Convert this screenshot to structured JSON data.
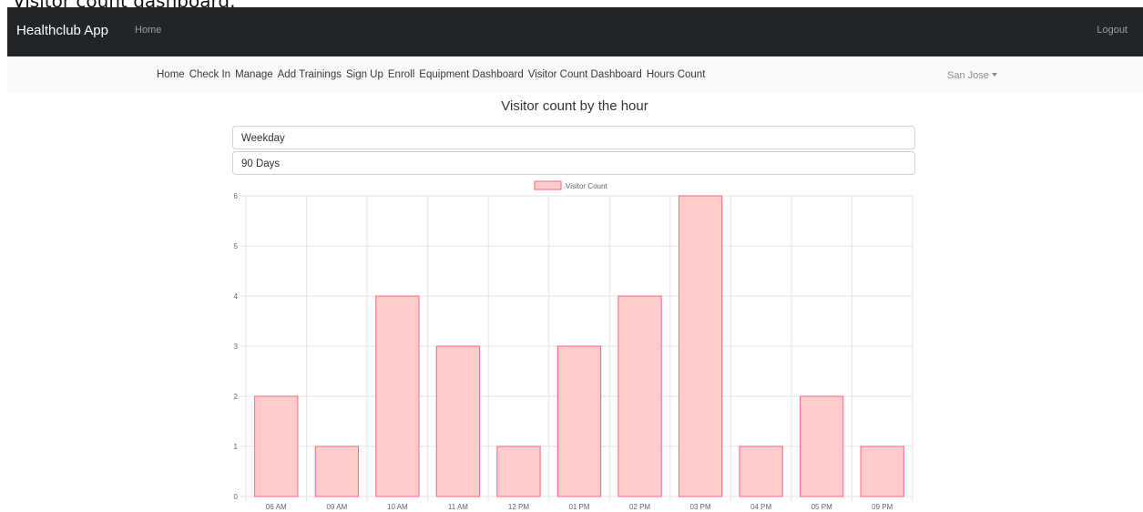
{
  "page": {
    "caption": "Visitor count dashboard:"
  },
  "navbar": {
    "brand": "Healthclub App",
    "home_link": "Home",
    "logout_label": "Logout"
  },
  "subnav": {
    "links": [
      "Home",
      "Check In",
      "Manage",
      "Add Trainings",
      "Sign Up",
      "Enroll",
      "Equipment Dashboard",
      "Visitor Count Dashboard",
      "Hours Count"
    ],
    "location": "San Jose"
  },
  "main": {
    "title": "Visitor count by the hour",
    "day_filter": "Weekday",
    "range_filter": "90 Days"
  },
  "colors": {
    "bar_fill": "#ffcccc",
    "bar_stroke": "#ff6384",
    "grid": "#e6e6e6",
    "tick_text": "#666666"
  },
  "chart_data": {
    "type": "bar",
    "categories": [
      "06 AM",
      "09 AM",
      "10 AM",
      "11 AM",
      "12 PM",
      "01 PM",
      "02 PM",
      "03 PM",
      "04 PM",
      "05 PM",
      "09 PM"
    ],
    "series": [
      {
        "name": "Visitor Count",
        "values": [
          2,
          1,
          4,
          3,
          1,
          3,
          4,
          6,
          1,
          2,
          1
        ]
      }
    ],
    "ylim": [
      0,
      6
    ],
    "yticks": [
      0,
      1,
      2,
      3,
      4,
      5,
      6
    ],
    "grid": true,
    "legend": "top-center"
  }
}
